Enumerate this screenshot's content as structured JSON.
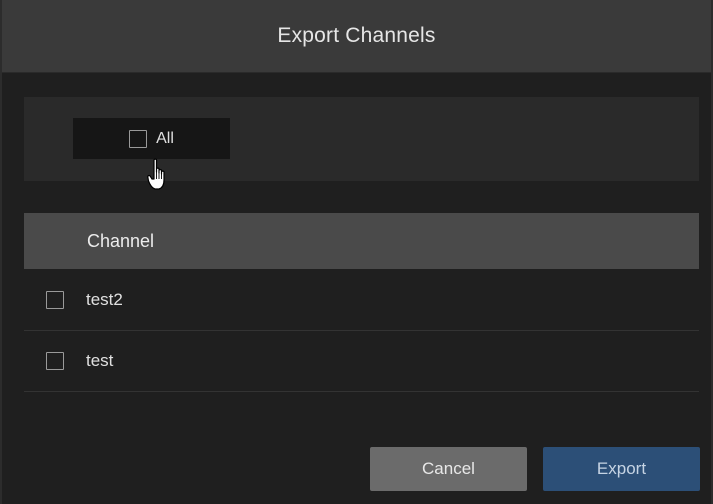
{
  "dialog": {
    "title": "Export Channels"
  },
  "select_all": {
    "label": "All",
    "checked": false
  },
  "table": {
    "column_header": "Channel",
    "rows": [
      {
        "label": "test2",
        "checked": false
      },
      {
        "label": "test",
        "checked": false
      }
    ]
  },
  "footer": {
    "cancel_label": "Cancel",
    "export_label": "Export"
  },
  "colors": {
    "header_bg": "#3a3a3a",
    "panel_bg": "#2a2a2a",
    "table_header_bg": "#4a4a4a",
    "cancel_bg": "#6b6b6b",
    "export_bg": "#2c4f77"
  },
  "icons": {
    "cursor": "hand-pointer-icon"
  }
}
